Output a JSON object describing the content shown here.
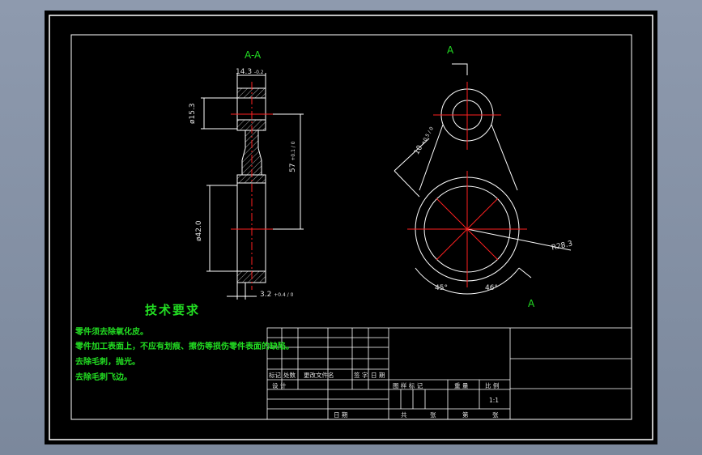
{
  "section": {
    "label": "A-A",
    "view_marker": "A"
  },
  "dimensions": {
    "width_top": "14.3",
    "width_top_tol": "-0.2",
    "dia_small": "ø15.3",
    "dia_large": "ø42.0",
    "center_dist": "57",
    "center_dist_tol": "+0.1 / 0",
    "bottom_gap": "3.2",
    "bottom_gap_tol": "+0.4 / 0",
    "slot": "10",
    "slot_tol": "+0.5 / 0",
    "radius": "R28.3",
    "angle_left": "45°",
    "angle_right": "46°"
  },
  "tech": {
    "title": "技术要求",
    "lines": [
      "零件须去除氧化皮。",
      "零件加工表面上，不应有划痕、擦伤等损伤零件表面的缺陷。",
      "去除毛刺，抛光。",
      "去除毛刺飞边。"
    ]
  },
  "title_block": {
    "rev_headers": [
      "标记",
      "处数",
      "更改文件名",
      "签 字",
      "日 期"
    ],
    "design": "设 计",
    "date": "日 期",
    "stage_header": "图 样 标 记",
    "weight": "重 量",
    "scale_label": "比 例",
    "scale_value": "1:1",
    "total": "共",
    "sheets": "张",
    "sheet_no": "第",
    "sheet_suffix": "张"
  }
}
